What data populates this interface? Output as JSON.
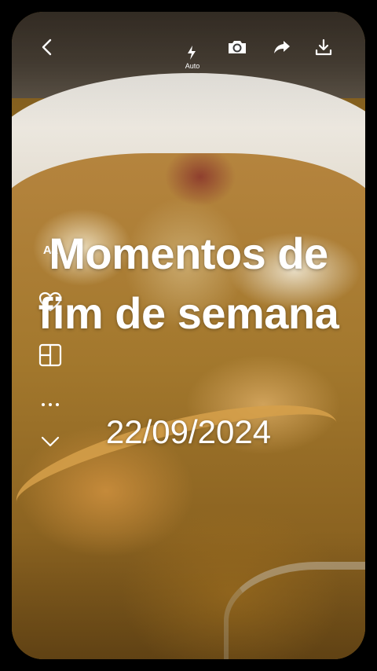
{
  "toolbar": {
    "back_icon": "chevron-left-icon",
    "flash_icon": "flash-icon",
    "flash_label": "Auto",
    "camera_icon": "camera-icon",
    "share_icon": "share-arrow-icon",
    "download_icon": "download-icon"
  },
  "side_tools": {
    "text_tool_label": "Aa",
    "items": [
      "heart-icon",
      "layout-icon",
      "more-dots-icon",
      "chevron-down-icon"
    ]
  },
  "overlay": {
    "title": "Momentos de fim de semana",
    "date": "22/09/2024"
  }
}
